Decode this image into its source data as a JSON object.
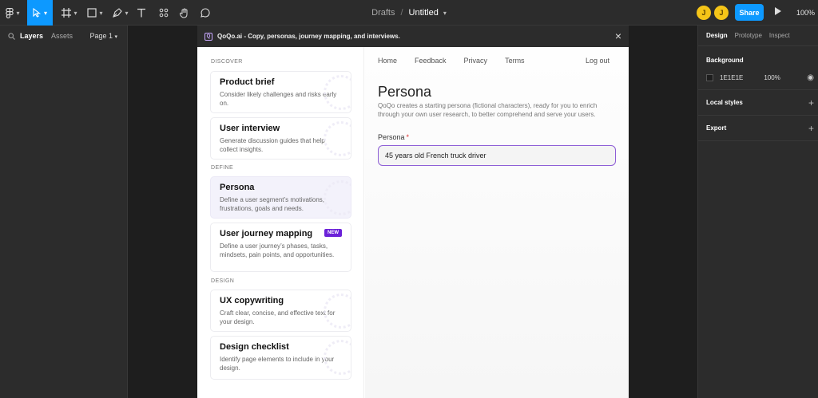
{
  "toolbar": {
    "tools": [
      "main-menu",
      "move",
      "frame",
      "shape",
      "pen",
      "text",
      "resources",
      "hand",
      "comment"
    ],
    "breadcrumb_folder": "Drafts",
    "breadcrumb_sep": "/",
    "file_name": "Untitled",
    "avatars": [
      "J",
      "J"
    ],
    "share_label": "Share",
    "zoom": "100%"
  },
  "left_panel": {
    "tab_layers": "Layers",
    "tab_assets": "Assets",
    "page": "Page 1"
  },
  "right_panel": {
    "tab_design": "Design",
    "tab_prototype": "Prototype",
    "tab_inspect": "Inspect",
    "background_title": "Background",
    "background_hex": "1E1E1E",
    "background_opacity": "100%",
    "local_styles": "Local styles",
    "export": "Export",
    "colors": {
      "accent": "#0d99ff",
      "avatar": "#f5c518"
    }
  },
  "plugin": {
    "title": "QoQo.ai - Copy, personas, journey mapping, and interviews.",
    "close": "×",
    "sections": {
      "discover": "DISCOVER",
      "define": "DEFINE",
      "design": "DESIGN"
    },
    "cards": {
      "product_brief": {
        "title": "Product brief",
        "desc": "Consider likely challenges and risks early on."
      },
      "user_interview": {
        "title": "User interview",
        "desc": "Generate discussion guides that help collect insights."
      },
      "persona": {
        "title": "Persona",
        "desc": "Define a user segment’s motivations, frustrations, goals and needs."
      },
      "journey": {
        "title": "User journey mapping",
        "badge": "NEW",
        "desc": "Define a user journey’s phases, tasks, mindsets, pain points, and opportunities."
      },
      "ux_copy": {
        "title": "UX copywriting",
        "desc": "Craft clear, concise, and effective text for your design."
      },
      "checklist": {
        "title": "Design checklist",
        "desc": "Identify page elements to include in your design."
      }
    },
    "nav": {
      "home": "Home",
      "feedback": "Feedback",
      "privacy": "Privacy",
      "terms": "Terms",
      "logout": "Log out"
    },
    "main": {
      "title": "Persona",
      "description": "QoQo creates a starting persona (fictional characters), ready for you to enrich through your own user research, to better comprehend and serve your users.",
      "field_label": "Persona",
      "required_mark": "*",
      "input_value": "45 years old French truck driver"
    },
    "colors": {
      "brand": "#6b21d8",
      "input_border": "#8e5fd6"
    }
  }
}
